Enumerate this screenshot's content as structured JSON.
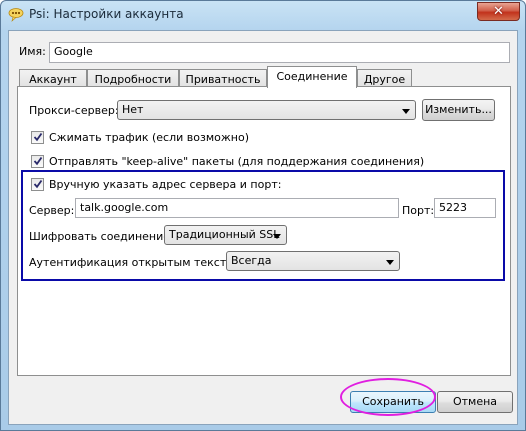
{
  "window": {
    "title": "Psi: Настройки аккаунта",
    "close_label": "✕"
  },
  "name_field": {
    "label": "Имя:",
    "value": "Google"
  },
  "tabs": [
    {
      "label": "Аккаунт",
      "active": false
    },
    {
      "label": "Подробности",
      "active": false
    },
    {
      "label": "Приватность",
      "active": false
    },
    {
      "label": "Соединение",
      "active": true
    },
    {
      "label": "Другое",
      "active": false
    }
  ],
  "connection": {
    "proxy_label": "Прокси-сервер:",
    "proxy_value": "Нет",
    "proxy_change_button": "Изменить...",
    "compress_label": "Сжимать трафик (если возможно)",
    "compress_checked": true,
    "keepalive_label": "Отправлять \"keep-alive\" пакеты (для поддержания соединения)",
    "keepalive_checked": true,
    "manual_host_label": "Вручную указать адрес сервера и порт:",
    "manual_host_checked": true,
    "server_label": "Сервер:",
    "server_value": "talk.google.com",
    "port_label": "Порт:",
    "port_value": "5223",
    "encrypt_label": "Шифровать соединение:",
    "encrypt_value": "Традиционный SSL",
    "plaintext_auth_label": "Аутентификация открытым текстом:",
    "plaintext_auth_value": "Всегда"
  },
  "footer": {
    "save_button": "Сохранить",
    "cancel_button": "Отмена"
  },
  "colors": {
    "annotation_box": "#0a0aa8",
    "annotation_ellipse": "#e01ee0"
  }
}
